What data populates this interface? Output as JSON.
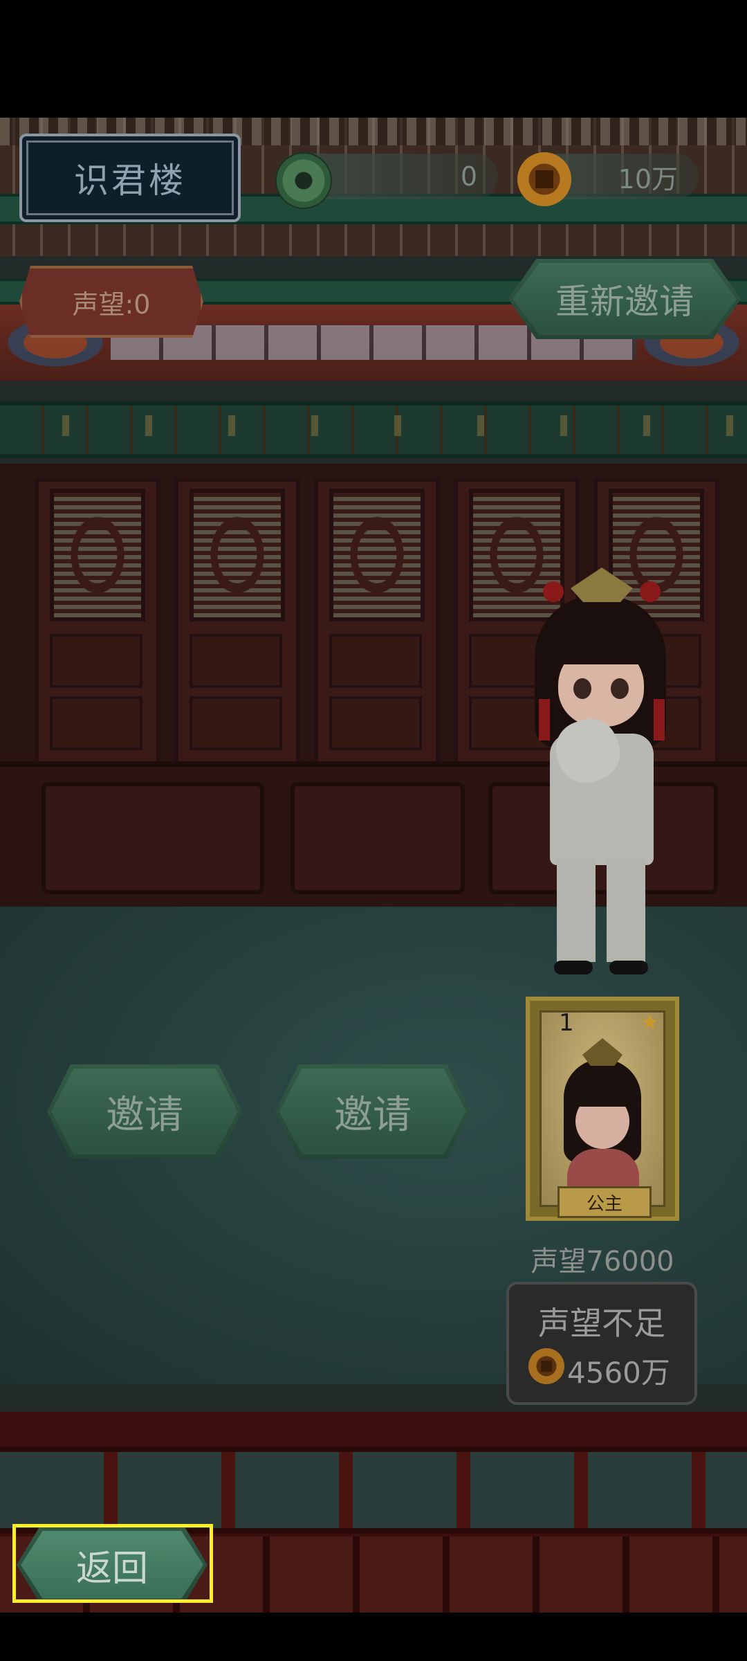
{
  "header": {
    "title": "识君楼",
    "jade_count": "0",
    "gold_count": "10万",
    "reputation": "声望:0",
    "reinvite_label": "重新邀请"
  },
  "invite_slots": [
    {
      "label": "邀请"
    },
    {
      "label": "邀请"
    }
  ],
  "card": {
    "rank": "1",
    "name": "公主",
    "reputation_required": "声望76000",
    "status": "声望不足",
    "cost": "4560万",
    "star_icon": "star-icon"
  },
  "footer": {
    "back_label": "返回"
  },
  "colors": {
    "jade_button": "#3d6a55",
    "highlight": "#ffee2a",
    "title_bg": "#0f1f2a"
  }
}
